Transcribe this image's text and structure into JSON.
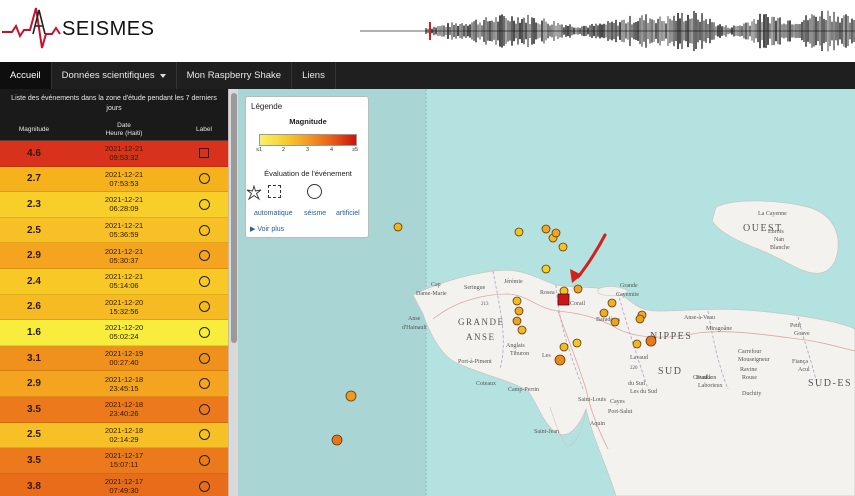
{
  "header": {
    "logo_text": "SEISMES"
  },
  "nav": {
    "items": [
      {
        "label": "Accueil",
        "active": true
      },
      {
        "label": "Données scientifiques",
        "dropdown": true
      },
      {
        "label": "Mon Raspberry Shake"
      },
      {
        "label": "Liens"
      }
    ]
  },
  "event_panel": {
    "title": "Liste des événements dans la zone d'étude pendant les 7 derniers jours",
    "col_magnitude": "Magnitude",
    "col_date": "Date",
    "col_time": "Heure (Haiti)",
    "col_label": "Label",
    "events": [
      {
        "magnitude": "4.6",
        "date": "2021-12-21",
        "time": "09:53:32",
        "label": "automatique",
        "color": "#d9321c"
      },
      {
        "magnitude": "2.7",
        "date": "2021-12-21",
        "time": "07:53:53",
        "label": "séisme",
        "color": "#f6b21c"
      },
      {
        "magnitude": "2.3",
        "date": "2021-12-21",
        "time": "06:28:09",
        "label": "séisme",
        "color": "#f8cf28"
      },
      {
        "magnitude": "2.5",
        "date": "2021-12-21",
        "time": "05:36:59",
        "label": "séisme",
        "color": "#f7c026"
      },
      {
        "magnitude": "2.9",
        "date": "2021-12-21",
        "time": "05:30:37",
        "label": "séisme",
        "color": "#f4a41f"
      },
      {
        "magnitude": "2.4",
        "date": "2021-12-21",
        "time": "05:14:06",
        "label": "séisme",
        "color": "#f8c826"
      },
      {
        "magnitude": "2.6",
        "date": "2021-12-20",
        "time": "15:32:56",
        "label": "séisme",
        "color": "#f6ba22"
      },
      {
        "magnitude": "1.6",
        "date": "2021-12-20",
        "time": "05:02:24",
        "label": "séisme",
        "color": "#f8ec3c"
      },
      {
        "magnitude": "3.1",
        "date": "2021-12-19",
        "time": "00:27:40",
        "label": "séisme",
        "color": "#f0901d"
      },
      {
        "magnitude": "2.9",
        "date": "2021-12-18",
        "time": "23:45:15",
        "label": "séisme",
        "color": "#f4a41f"
      },
      {
        "magnitude": "3.5",
        "date": "2021-12-18",
        "time": "23:40:26",
        "label": "séisme",
        "color": "#ec7a1c"
      },
      {
        "magnitude": "2.5",
        "date": "2021-12-18",
        "time": "02:14:29",
        "label": "séisme",
        "color": "#f7c026"
      },
      {
        "magnitude": "3.5",
        "date": "2021-12-17",
        "time": "15:07:11",
        "label": "séisme",
        "color": "#ec7a1c"
      },
      {
        "magnitude": "3.8",
        "date": "2021-12-17",
        "time": "07:49:30",
        "label": "séisme",
        "color": "#e96c1b"
      }
    ]
  },
  "legend": {
    "title": "Légende",
    "magnitude_title": "Magnitude",
    "ticks": [
      "≤1",
      "2",
      "3",
      "4",
      "≥5"
    ],
    "evaluation_title": "Évaluation de l'événement",
    "eval_labels": [
      "automatique",
      "séisme",
      "artificiel"
    ],
    "more_link": "Voir plus",
    "colors": {
      "low": "#f9f06a",
      "high": "#c9140d"
    }
  },
  "map": {
    "places": [
      {
        "text": "OUEST",
        "size": 10
      },
      {
        "text": "La Cayenne",
        "size": 6
      },
      {
        "text": "Ebrois",
        "size": 6
      },
      {
        "text": "Nan",
        "size": 6
      },
      {
        "text": "Blanche",
        "size": 6
      },
      {
        "text": "Cap",
        "size": 6
      },
      {
        "text": "Dame-Marie",
        "size": 6
      },
      {
        "text": "Jérémie",
        "size": 6
      },
      {
        "text": "Seringue",
        "size": 6
      },
      {
        "text": "Anse",
        "size": 6
      },
      {
        "text": "d'Hainault",
        "size": 6
      },
      {
        "text": "GRANDE",
        "size": 9
      },
      {
        "text": "ANSE",
        "size": 9
      },
      {
        "text": "Corail",
        "size": 6
      },
      {
        "text": "Rosea",
        "size": 6
      },
      {
        "text": "Grande",
        "size": 6
      },
      {
        "text": "Cayemite",
        "size": 6
      },
      {
        "text": "Baradères",
        "size": 6
      },
      {
        "text": "Anse-à-Veau",
        "size": 6
      },
      {
        "text": "Petit",
        "size": 6
      },
      {
        "text": "Goave",
        "size": 6
      },
      {
        "text": "NIPPES",
        "size": 10
      },
      {
        "text": "Miragoâne",
        "size": 6
      },
      {
        "text": "SUD",
        "size": 10
      },
      {
        "text": "SUD-ES",
        "size": 10
      },
      {
        "text": "Carrefour",
        "size": 6
      },
      {
        "text": "Mouseigneur",
        "size": 6
      },
      {
        "text": "Ravine",
        "size": 6
      },
      {
        "text": "Rouse",
        "size": 6
      },
      {
        "text": "Fiança",
        "size": 6
      },
      {
        "text": "Acul",
        "size": 6
      },
      {
        "text": "Bunka",
        "size": 6
      },
      {
        "text": "Laborieux",
        "size": 6
      },
      {
        "text": "Duchity",
        "size": 6
      },
      {
        "text": "Les",
        "size": 6
      },
      {
        "text": "Anglais",
        "size": 6
      },
      {
        "text": "Tiburon",
        "size": 6
      },
      {
        "text": "Port-à-Piment",
        "size": 6
      },
      {
        "text": "Coteaux",
        "size": 6
      },
      {
        "text": "Camp-Perrin",
        "size": 6
      },
      {
        "text": "Saint-Louis",
        "size": 6
      },
      {
        "text": "du Sud",
        "size": 6
      },
      {
        "text": "Les du Sud",
        "size": 6
      },
      {
        "text": "Cayes",
        "size": 6
      },
      {
        "text": "Port-Salut",
        "size": 6
      },
      {
        "text": "Saint-Jean",
        "size": 6
      },
      {
        "text": "Aquin",
        "size": 6
      },
      {
        "text": "Cavaillon",
        "size": 6
      },
      {
        "text": "Lavaud",
        "size": 6
      },
      {
        "text": "220",
        "size": 5
      },
      {
        "text": "213",
        "size": 5
      }
    ]
  }
}
